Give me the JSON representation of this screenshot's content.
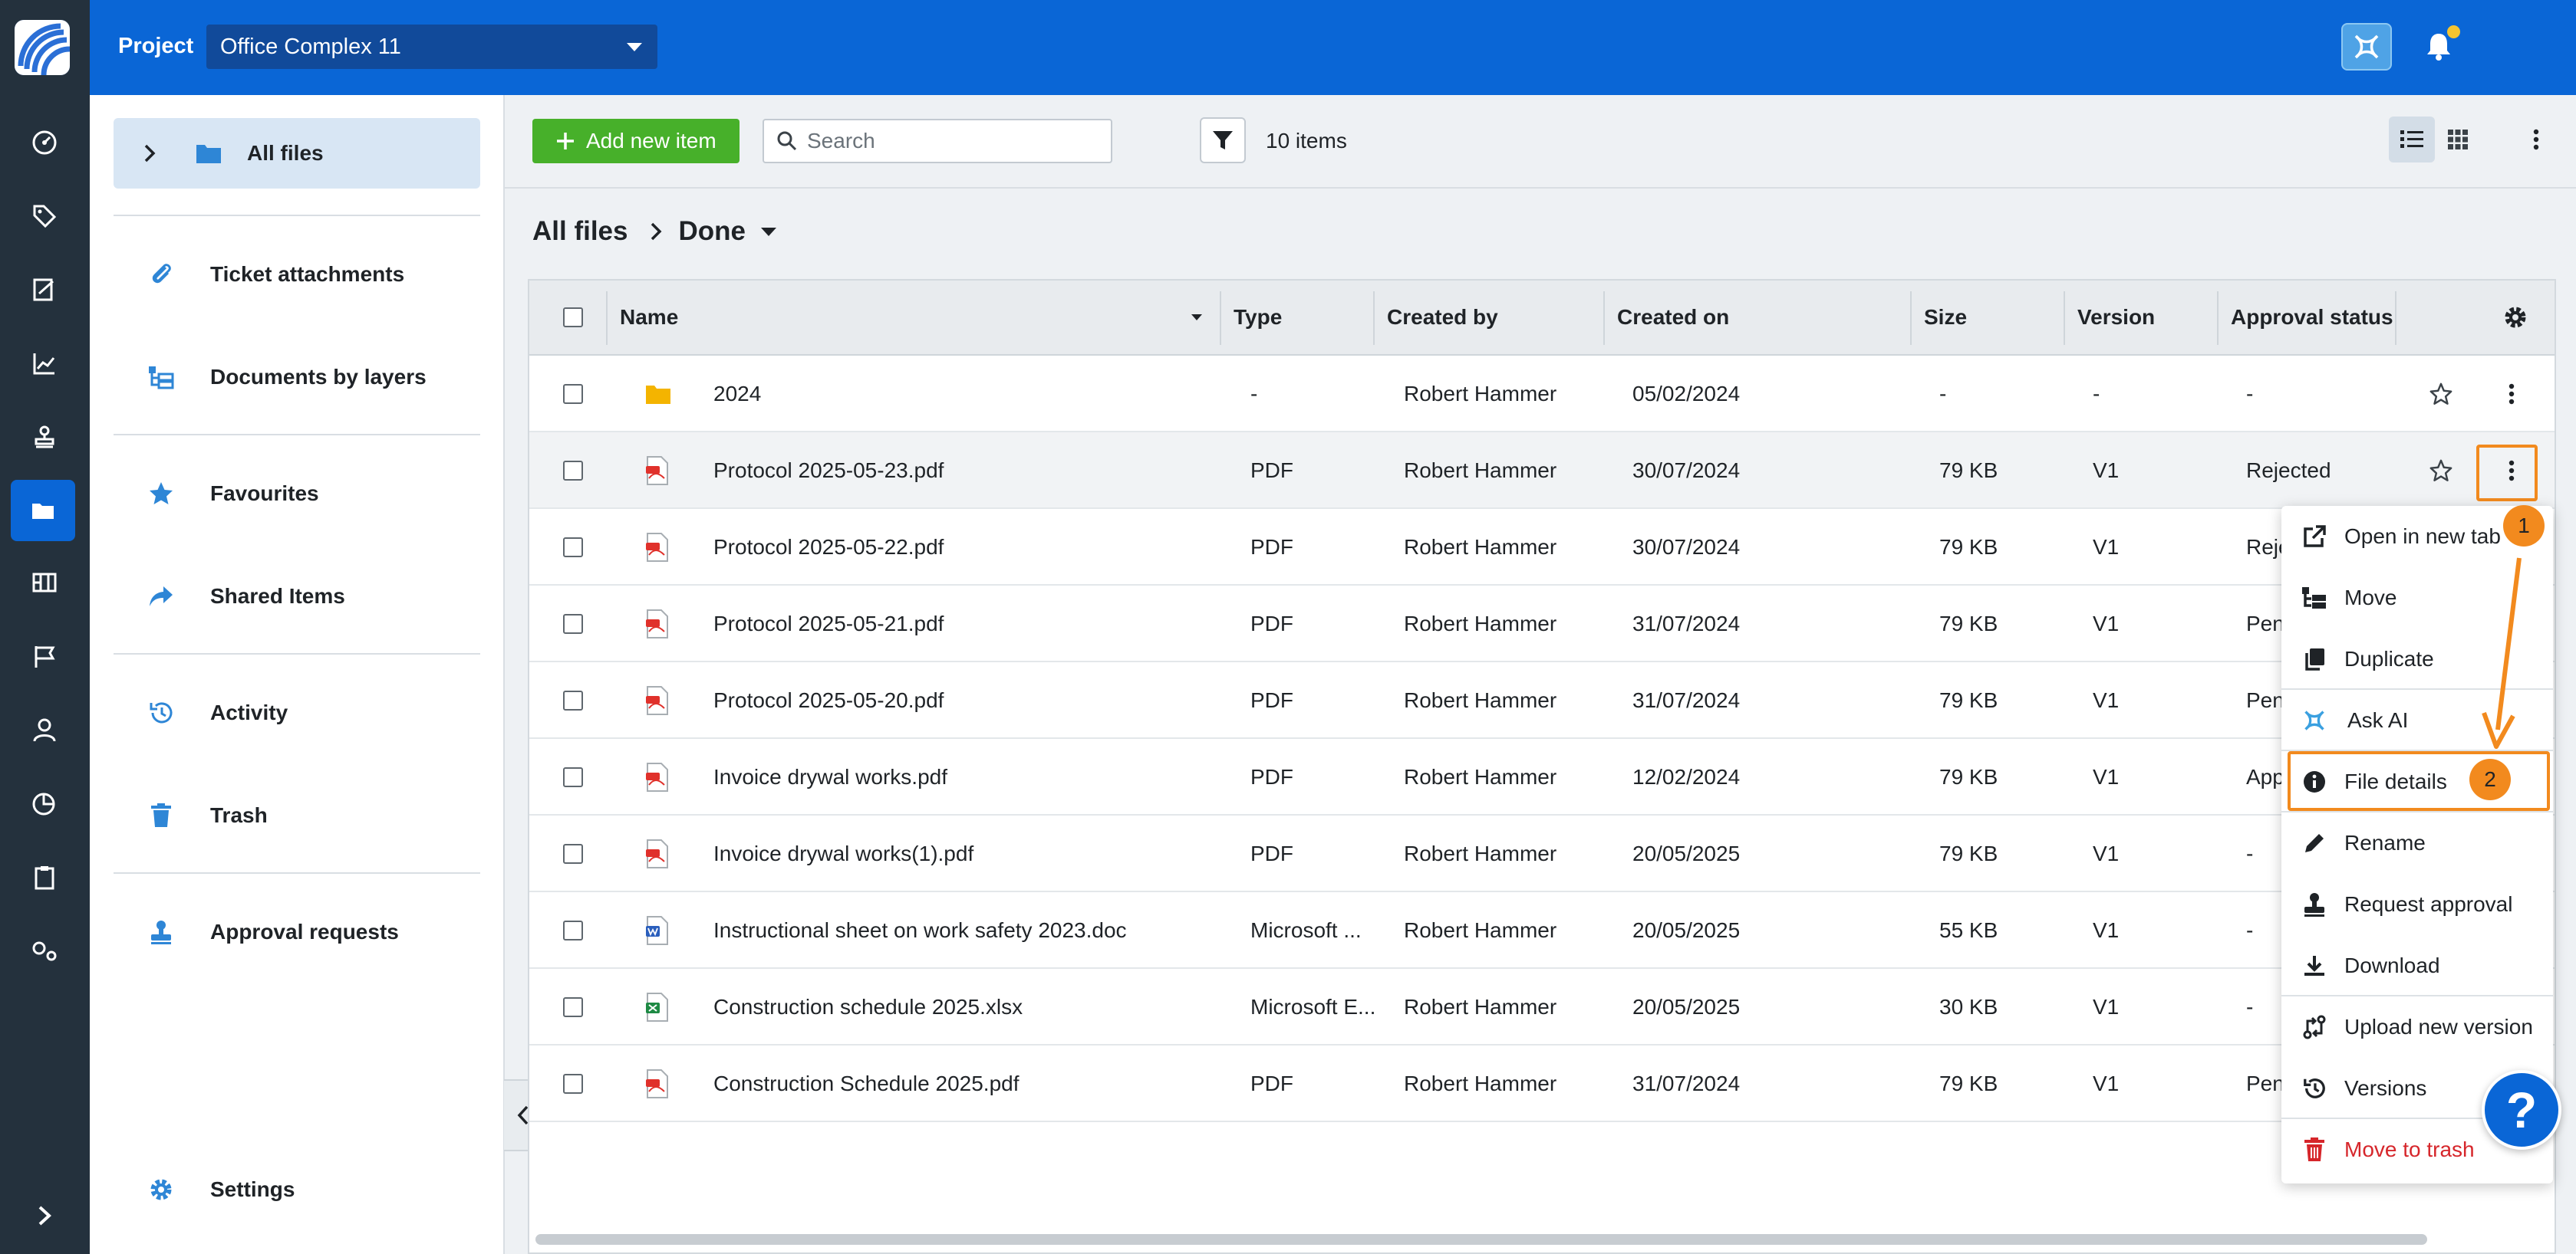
{
  "topbar": {
    "project_label": "Project",
    "project_value": "Office Complex 11"
  },
  "sidebar": {
    "items": [
      {
        "label": "All files",
        "icon": "folder-icon",
        "active": true
      },
      {
        "label": "Ticket attachments",
        "icon": "paperclip-icon"
      },
      {
        "label": "Documents by layers",
        "icon": "layers-tree-icon"
      },
      {
        "label": "Favourites",
        "icon": "star-icon"
      },
      {
        "label": "Shared Items",
        "icon": "share-icon"
      },
      {
        "label": "Activity",
        "icon": "history-icon"
      },
      {
        "label": "Trash",
        "icon": "trash-icon"
      },
      {
        "label": "Approval requests",
        "icon": "stamp-icon"
      },
      {
        "label": "Settings",
        "icon": "gear-icon"
      }
    ]
  },
  "toolbar": {
    "add_label": "Add new item",
    "search_placeholder": "Search",
    "item_count": "10 items"
  },
  "breadcrumb": {
    "root": "All files",
    "current": "Done"
  },
  "table": {
    "columns": {
      "name": "Name",
      "type": "Type",
      "created_by": "Created by",
      "created_on": "Created on",
      "size": "Size",
      "version": "Version",
      "approval": "Approval status"
    },
    "rows": [
      {
        "name": "2024",
        "kind": "folder",
        "type": "-",
        "created_by": "Robert Hammer",
        "created_on": "05/02/2024",
        "size": "-",
        "version": "-",
        "approval": "-"
      },
      {
        "name": "Protocol 2025-05-23.pdf",
        "kind": "pdf",
        "type": "PDF",
        "created_by": "Robert Hammer",
        "created_on": "30/07/2024",
        "size": "79 KB",
        "version": "V1",
        "approval": "Rejected"
      },
      {
        "name": "Protocol 2025-05-22.pdf",
        "kind": "pdf",
        "type": "PDF",
        "created_by": "Robert Hammer",
        "created_on": "30/07/2024",
        "size": "79 KB",
        "version": "V1",
        "approval": "Reje"
      },
      {
        "name": "Protocol 2025-05-21.pdf",
        "kind": "pdf",
        "type": "PDF",
        "created_by": "Robert Hammer",
        "created_on": "31/07/2024",
        "size": "79 KB",
        "version": "V1",
        "approval": "Pen"
      },
      {
        "name": "Protocol 2025-05-20.pdf",
        "kind": "pdf",
        "type": "PDF",
        "created_by": "Robert Hammer",
        "created_on": "31/07/2024",
        "size": "79 KB",
        "version": "V1",
        "approval": "Pen"
      },
      {
        "name": "Invoice drywal works.pdf",
        "kind": "pdf",
        "type": "PDF",
        "created_by": "Robert Hammer",
        "created_on": "12/02/2024",
        "size": "79 KB",
        "version": "V1",
        "approval": "App"
      },
      {
        "name": "Invoice drywal works(1).pdf",
        "kind": "pdf",
        "type": "PDF",
        "created_by": "Robert Hammer",
        "created_on": "20/05/2025",
        "size": "79 KB",
        "version": "V1",
        "approval": "-"
      },
      {
        "name": "Instructional sheet on work safety 2023.doc",
        "kind": "doc",
        "type": "Microsoft ...",
        "created_by": "Robert Hammer",
        "created_on": "20/05/2025",
        "size": "55 KB",
        "version": "V1",
        "approval": "-"
      },
      {
        "name": "Construction schedule 2025.xlsx",
        "kind": "xlsx",
        "type": "Microsoft E...",
        "created_by": "Robert Hammer",
        "created_on": "20/05/2025",
        "size": "30 KB",
        "version": "V1",
        "approval": "-"
      },
      {
        "name": "Construction Schedule 2025.pdf",
        "kind": "pdf",
        "type": "PDF",
        "created_by": "Robert Hammer",
        "created_on": "31/07/2024",
        "size": "79 KB",
        "version": "V1",
        "approval": "Pen"
      }
    ]
  },
  "context_menu": {
    "items": [
      {
        "label": "Open in new tab",
        "icon": "external-link-icon"
      },
      {
        "label": "Move",
        "icon": "move-icon"
      },
      {
        "label": "Duplicate",
        "icon": "copy-icon"
      },
      {
        "label": "Ask AI",
        "icon": "ai-icon"
      },
      {
        "label": "File details",
        "icon": "info-icon"
      },
      {
        "label": "Rename",
        "icon": "pencil-icon"
      },
      {
        "label": "Request approval",
        "icon": "stamp-icon"
      },
      {
        "label": "Download",
        "icon": "download-icon"
      },
      {
        "label": "Upload new version",
        "icon": "upload-version-icon"
      },
      {
        "label": "Versions",
        "icon": "history-icon"
      },
      {
        "label": "Move to trash",
        "icon": "trash-icon"
      }
    ]
  },
  "annotations": {
    "badge_1": "1",
    "badge_2": "2",
    "highlight_color": "#f28a1e"
  },
  "help_label": "?",
  "colors": {
    "brand_blue": "#0a66d6",
    "rail": "#24313d",
    "add_green": "#47b02a",
    "danger_red": "#d6262b"
  }
}
